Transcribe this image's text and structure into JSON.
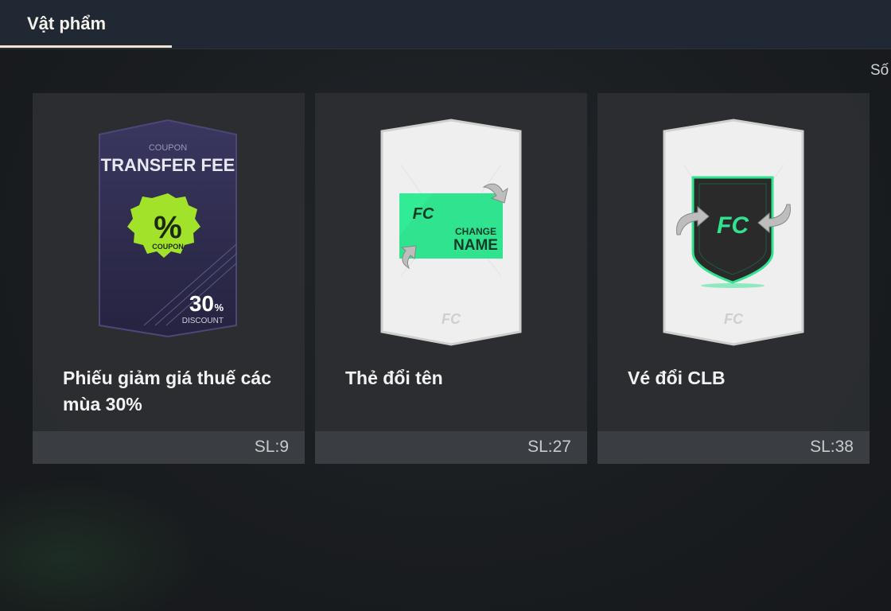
{
  "header": {
    "tab_label": "Vật phẩm"
  },
  "toolbar": {
    "sort_label": "Số"
  },
  "items": [
    {
      "name": "Phiếu giảm giá thuế các mùa 30%",
      "quantity": "SL:9",
      "art": {
        "coupon_label": "COUPON",
        "title": "TRANSFER FEE",
        "badge_symbol": "%",
        "badge_label": "COUPON",
        "discount_value": "30",
        "discount_unit": "%",
        "discount_label": "DISCOUNT",
        "card_color": "#2e2c4f",
        "badge_color": "#a3e22b"
      }
    },
    {
      "name": "Thẻ đổi tên",
      "quantity": "SL:27",
      "art": {
        "line1": "CHANGE",
        "line2": "NAME",
        "ticket_color": "#2fe38f"
      }
    },
    {
      "name": "Vé đổi CLB",
      "quantity": "SL:38",
      "art": {
        "shield_color": "#2a2a2a",
        "accent_color": "#2fe38f"
      }
    }
  ]
}
